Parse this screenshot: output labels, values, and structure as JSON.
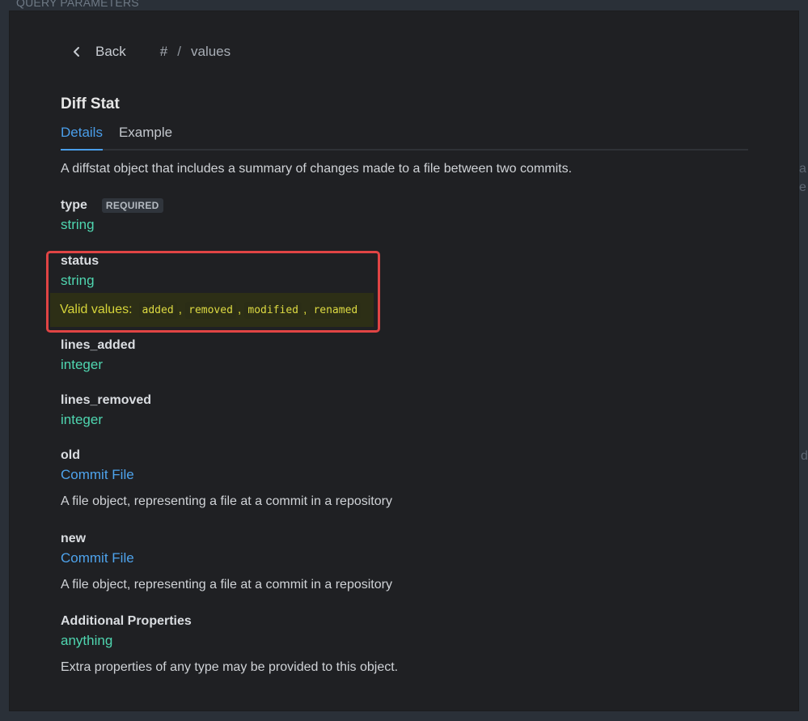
{
  "background": {
    "section_header": "QUERY PARAMETERS",
    "edge_letters": [
      "a",
      "e",
      "d"
    ]
  },
  "nav": {
    "back_label": "Back",
    "breadcrumb": [
      "#",
      "values"
    ]
  },
  "schema": {
    "title": "Diff Stat",
    "tabs": [
      {
        "label": "Details",
        "active": true
      },
      {
        "label": "Example",
        "active": false
      }
    ],
    "description": "A diffstat object that includes a summary of changes made to a file between two commits.",
    "properties": [
      {
        "name": "type",
        "badge": "REQUIRED",
        "type": "string"
      },
      {
        "name": "status",
        "type": "string",
        "valid_label": "Valid values:",
        "valid_values": [
          "added",
          "removed",
          "modified",
          "renamed"
        ]
      },
      {
        "name": "lines_added",
        "type": "integer"
      },
      {
        "name": "lines_removed",
        "type": "integer"
      },
      {
        "name": "old",
        "type": "Commit File",
        "description": "A file object, representing a file at a commit in a repository"
      },
      {
        "name": "new",
        "type": "Commit File",
        "description": "A file object, representing a file at a commit in a repository"
      },
      {
        "name": "Additional Properties",
        "type": "anything",
        "description": "Extra properties of any type may be provided to this object."
      }
    ]
  },
  "colors": {
    "panel_bg": "#1f2023",
    "accent_blue": "#4a9eea",
    "type_green": "#4fd6b0",
    "highlight_border": "#e04444",
    "valid_yellow": "#d6d43a"
  }
}
